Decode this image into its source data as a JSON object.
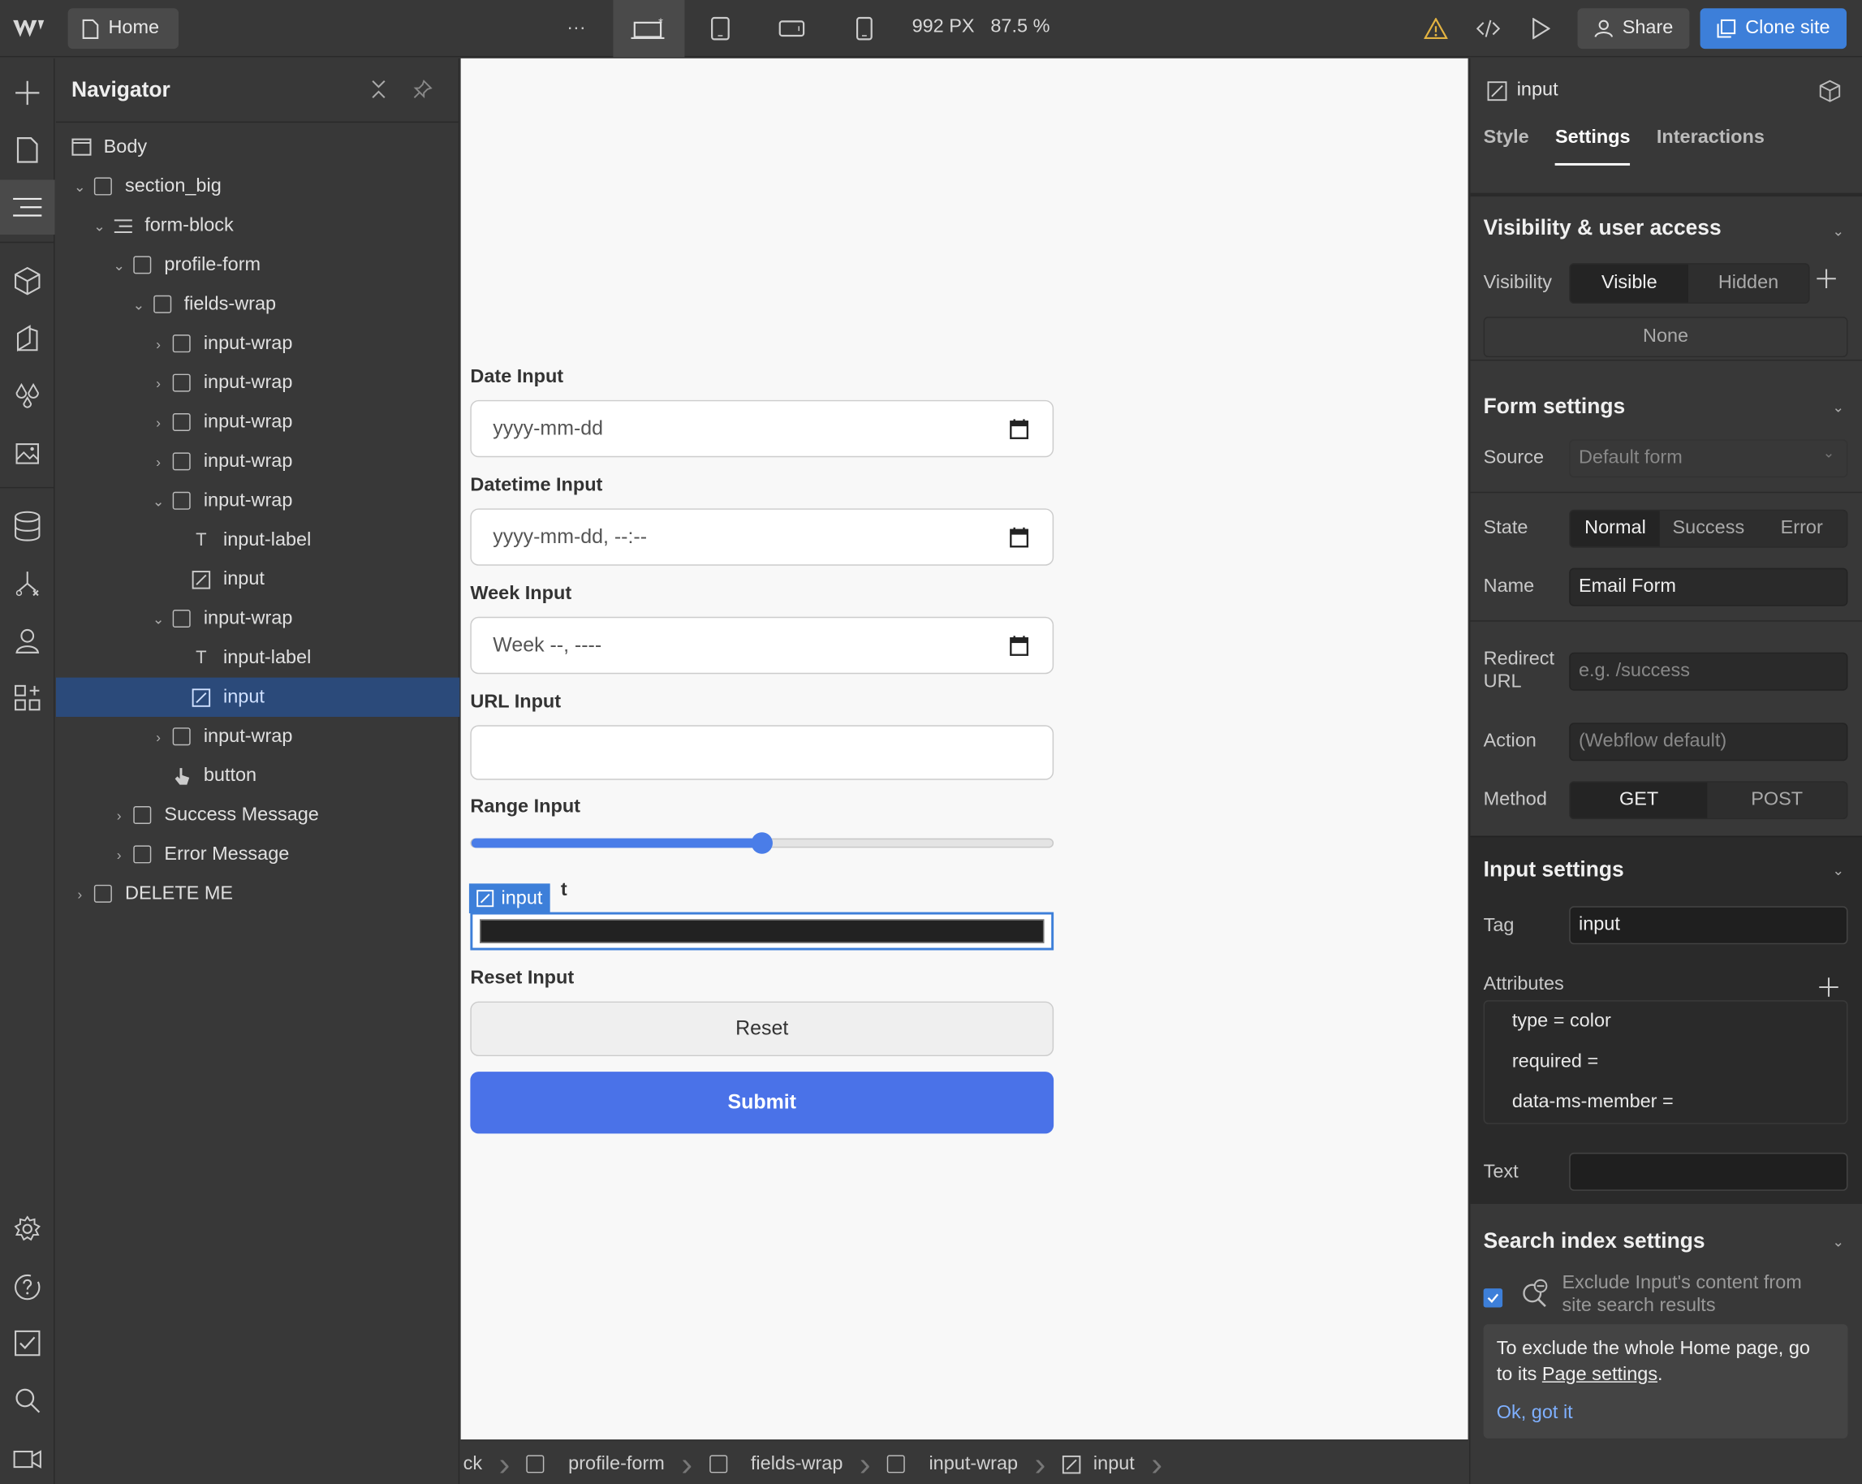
{
  "topbar": {
    "home_label": "Home",
    "more": "···",
    "width_px": "992 PX",
    "zoom": "87.5 %",
    "share_label": "Share",
    "clone_label": "Clone site"
  },
  "navigator": {
    "title": "Navigator",
    "items": [
      {
        "label": "Body",
        "depth": 0,
        "caret": "",
        "icon": "body-icon"
      },
      {
        "label": "section_big",
        "depth": 0,
        "caret": "⌄",
        "icon": "box-icon"
      },
      {
        "label": "form-block",
        "depth": 1,
        "caret": "⌄",
        "icon": "form-icon"
      },
      {
        "label": "profile-form",
        "depth": 2,
        "caret": "⌄",
        "icon": "box-icon"
      },
      {
        "label": "fields-wrap",
        "depth": 3,
        "caret": "⌄",
        "icon": "box-icon"
      },
      {
        "label": "input-wrap",
        "depth": 4,
        "caret": "›",
        "icon": "box-icon"
      },
      {
        "label": "input-wrap",
        "depth": 4,
        "caret": "›",
        "icon": "box-icon"
      },
      {
        "label": "input-wrap",
        "depth": 4,
        "caret": "›",
        "icon": "box-icon"
      },
      {
        "label": "input-wrap",
        "depth": 4,
        "caret": "›",
        "icon": "box-icon"
      },
      {
        "label": "input-wrap",
        "depth": 4,
        "caret": "⌄",
        "icon": "box-icon"
      },
      {
        "label": "input-label",
        "depth": 5,
        "caret": "",
        "icon": "text-icon"
      },
      {
        "label": "input",
        "depth": 5,
        "caret": "",
        "icon": "input-icon"
      },
      {
        "label": "input-wrap",
        "depth": 4,
        "caret": "⌄",
        "icon": "box-icon"
      },
      {
        "label": "input-label",
        "depth": 5,
        "caret": "",
        "icon": "text-icon"
      },
      {
        "label": "input",
        "depth": 5,
        "caret": "",
        "icon": "input-icon",
        "selected": true
      },
      {
        "label": "input-wrap",
        "depth": 4,
        "caret": "›",
        "icon": "box-icon"
      },
      {
        "label": "button",
        "depth": 4,
        "caret": "",
        "icon": "button-icon"
      },
      {
        "label": "Success Message",
        "depth": 2,
        "caret": "›",
        "icon": "box-icon"
      },
      {
        "label": "Error Message",
        "depth": 2,
        "caret": "›",
        "icon": "box-icon"
      },
      {
        "label": "DELETE ME",
        "depth": 0,
        "caret": "›",
        "icon": "box-icon"
      }
    ]
  },
  "canvas": {
    "date_label": "Date Input",
    "date_value": "yyyy-mm-dd",
    "datetime_label": "Datetime Input",
    "datetime_value": "yyyy-mm-dd, --:--",
    "week_label": "Week Input",
    "week_value": "Week --, ----",
    "url_label": "URL Input",
    "range_label": "Range Input",
    "range_value_fraction": 0.5,
    "color_label_suffix": "t",
    "selected_badge": "input",
    "reset_label": "Reset Input",
    "reset_button": "Reset",
    "submit_button": "Submit"
  },
  "breadcrumbs": [
    "ck",
    "profile-form",
    "fields-wrap",
    "input-wrap",
    "input"
  ],
  "right_panel": {
    "element_name": "input",
    "tabs": [
      "Style",
      "Settings",
      "Interactions"
    ],
    "active_tab": "Settings",
    "visibility": {
      "title": "Visibility & user access",
      "label": "Visibility",
      "options": [
        "Visible",
        "Hidden"
      ],
      "none": "None"
    },
    "form_settings": {
      "title": "Form settings",
      "source_label": "Source",
      "source_value": "Default form",
      "state_label": "State",
      "states": [
        "Normal",
        "Success",
        "Error"
      ],
      "name_label": "Name",
      "name_value": "Email Form",
      "redirect_label_1": "Redirect",
      "redirect_label_2": "URL",
      "redirect_placeholder": "e.g. /success",
      "action_label": "Action",
      "action_placeholder": "(Webflow default)",
      "method_label": "Method",
      "methods": [
        "GET",
        "POST"
      ]
    },
    "input_settings": {
      "title": "Input settings",
      "tag_label": "Tag",
      "tag_value": "input",
      "attributes_label": "Attributes",
      "attributes": [
        "type = color",
        "required =",
        "data-ms-member ="
      ],
      "text_label": "Text"
    },
    "search_index": {
      "title": "Search index settings",
      "exclude_line1": "Exclude Input's content from",
      "exclude_line2": "site search results",
      "tip_line1": "To exclude the whole Home page, go",
      "tip_line2_prefix": "to its ",
      "tip_link": "Page settings",
      "tip_line2_suffix": ".",
      "ok_link": "Ok, got it"
    }
  },
  "colors": {
    "accent": "#3d7fd9",
    "submit": "#4a72e8",
    "selection": "#2b4a7a"
  }
}
